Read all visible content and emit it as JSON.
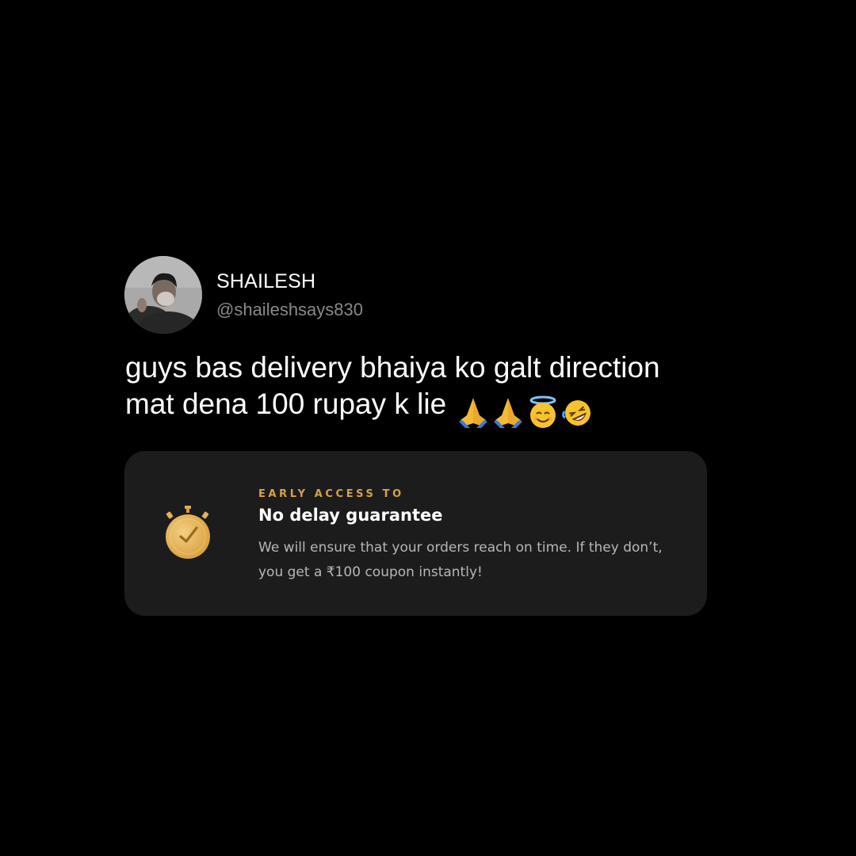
{
  "author": {
    "display_name": "SHAILESH",
    "handle": "@shaileshsays830"
  },
  "tweet": {
    "text": "guys bas delivery bhaiya ko galt direction\nmat dena 100 rupay k lie ",
    "emojis": [
      "folded-hands",
      "folded-hands",
      "smiling-face-with-halo",
      "rolling-on-the-floor-laughing"
    ]
  },
  "card": {
    "eyebrow": "EARLY ACCESS TO",
    "title": "No delay guarantee",
    "description": "We will ensure that your orders reach on time. If they don’t, you get a ₹100 coupon instantly!",
    "icon": "stopwatch-icon"
  },
  "colors": {
    "background": "#000000",
    "card_background": "#1c1c1c",
    "accent": "#d6a24a",
    "handle_text": "#8a8a8a",
    "description_text": "#b7b7b7"
  }
}
